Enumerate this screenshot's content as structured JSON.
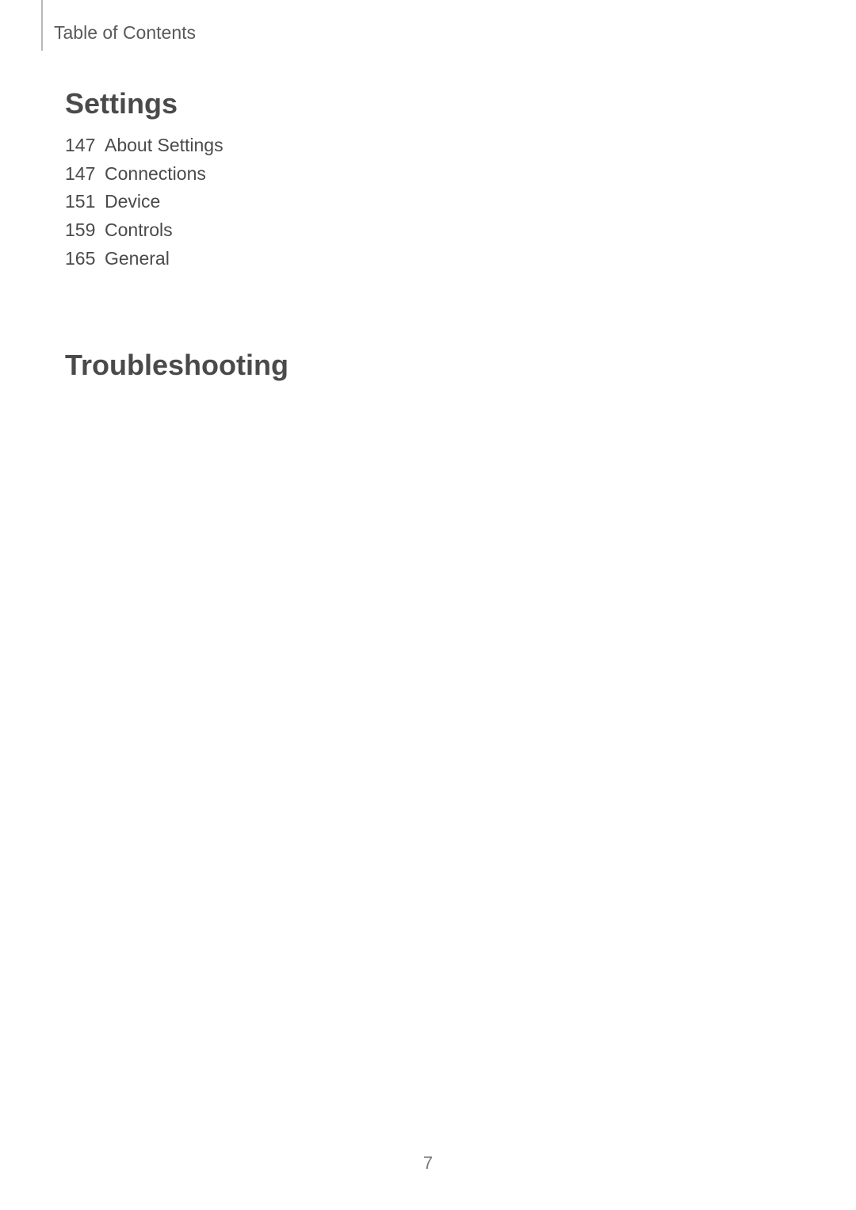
{
  "header": {
    "label": "Table of Contents"
  },
  "sections": [
    {
      "heading": "Settings",
      "entries": [
        {
          "page": "147",
          "title": "About Settings"
        },
        {
          "page": "147",
          "title": "Connections"
        },
        {
          "page": "151",
          "title": "Device"
        },
        {
          "page": "159",
          "title": "Controls"
        },
        {
          "page": "165",
          "title": "General"
        }
      ]
    },
    {
      "heading": "Troubleshooting",
      "entries": []
    }
  ],
  "pageNumber": "7"
}
